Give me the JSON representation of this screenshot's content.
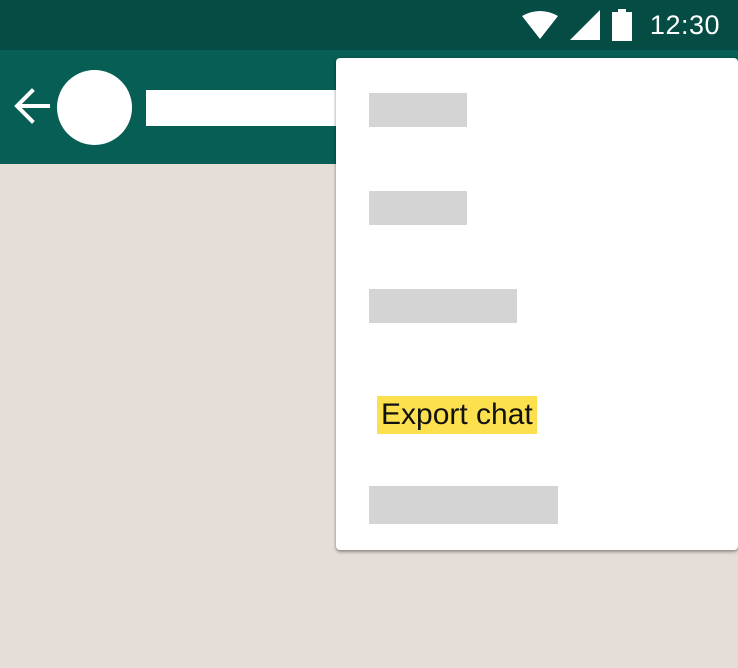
{
  "status_bar": {
    "time": "12:30",
    "icons": [
      "wifi-icon",
      "cellular-signal-icon",
      "battery-icon"
    ]
  },
  "app_bar": {
    "back_icon": "arrow-left-icon"
  },
  "overflow_menu": {
    "items": [
      {
        "label": ""
      },
      {
        "label": ""
      },
      {
        "label": ""
      },
      {
        "label": "Export chat",
        "highlight_color": "#fde04d"
      },
      {
        "label": ""
      }
    ]
  },
  "colors": {
    "status_bar": "#054d44",
    "app_bar": "#075e54",
    "chat_background": "#e5ddd8",
    "placeholder": "#d4d4d4",
    "highlight": "#fde04d"
  }
}
